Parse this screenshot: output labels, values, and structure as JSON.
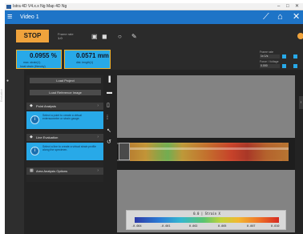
{
  "window": {
    "title": "Istra 4D V4.x.x Ng Map 4D Ng",
    "min_glyph": "–",
    "max_glyph": "□",
    "close_glyph": "✕"
  },
  "appbar": {
    "title": "Video 1",
    "menu_icon": "hamburger-icon",
    "measure_icon": "ruler-icon",
    "home_icon": "home-icon",
    "tools_icon": "tools-icon"
  },
  "toolbar": {
    "stop_label": "STOP",
    "field_label": "Frame rate",
    "field_value": "1.0",
    "icons": [
      "camera-icon",
      "record-icon",
      "settings-icon",
      "pencil-icon"
    ]
  },
  "stats": {
    "card1": {
      "value": "0.0955 %",
      "label1": "max. strain(1)",
      "label2": "local strain (Hencky)"
    },
    "card2": {
      "value": "0.0571 mm",
      "label": "dist. length(1)"
    },
    "right": [
      {
        "label": "Frame rate",
        "value": "1x 1/s"
      },
      {
        "label": "Force / Voltage",
        "value": "0.000"
      }
    ]
  },
  "leftstrip": {
    "label": "Evaluation"
  },
  "panel": {
    "button1": "Load Project",
    "button2": "Load Reference Image",
    "sections": [
      {
        "title": "Point Analysis",
        "info": "Select a point to create a virtual extensometer or strain gauge."
      },
      {
        "title": "Line Evaluation",
        "info": "Select a line to create a virtual strain profile along the specimen."
      },
      {
        "title": "Area Analysis Options",
        "info": ""
      }
    ]
  },
  "vtools": [
    "monitor-icon",
    "note-icon",
    "phone-icon",
    "grid-icon",
    "cursor-icon",
    "undo-icon"
  ],
  "legend": {
    "title": "0.0 | Strain X",
    "ticks": [
      "-0.004",
      "-0.001",
      "0.002",
      "0.005",
      "0.007",
      "0.010"
    ]
  }
}
